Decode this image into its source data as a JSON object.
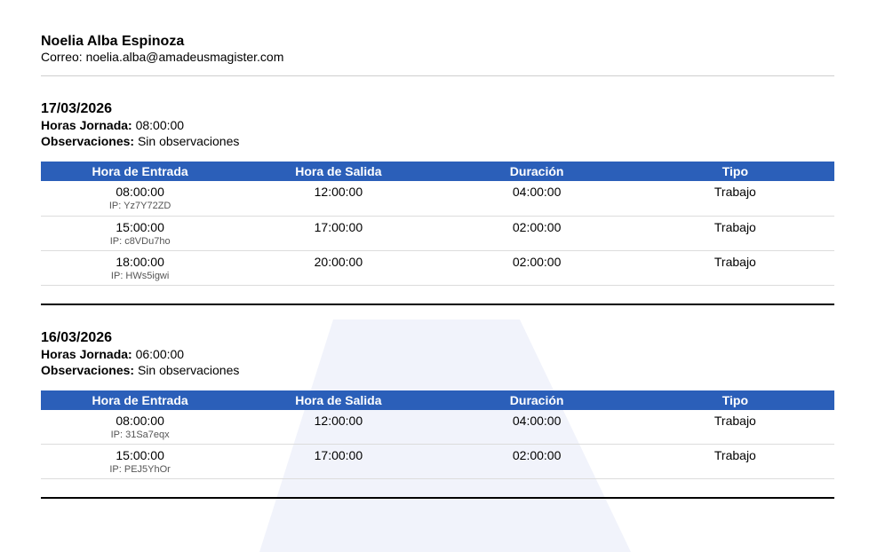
{
  "colors": {
    "accent": "#2b5fb9",
    "watermark": "#f1f3fb"
  },
  "person": {
    "name": "Noelia Alba Espinoza",
    "email_label": "Correo:",
    "email": "noelia.alba@amadeusmagister.com"
  },
  "labels": {
    "hours": "Horas Jornada:",
    "observations": "Observaciones:"
  },
  "columns": [
    "Hora de Entrada",
    "Hora de Salida",
    "Duración",
    "Tipo"
  ],
  "days": [
    {
      "date": "17/03/2026",
      "hours": "08:00:00",
      "observations": "Sin observaciones",
      "rows": [
        {
          "entry": "08:00:00",
          "ip": "IP: Yz7Y72ZD",
          "exit": "12:00:00",
          "duration": "04:00:00",
          "type": "Trabajo"
        },
        {
          "entry": "15:00:00",
          "ip": "IP: c8VDu7ho",
          "exit": "17:00:00",
          "duration": "02:00:00",
          "type": "Trabajo"
        },
        {
          "entry": "18:00:00",
          "ip": "IP: HWs5igwi",
          "exit": "20:00:00",
          "duration": "02:00:00",
          "type": "Trabajo"
        }
      ]
    },
    {
      "date": "16/03/2026",
      "hours": "06:00:00",
      "observations": "Sin observaciones",
      "rows": [
        {
          "entry": "08:00:00",
          "ip": "IP: 31Sa7eqx",
          "exit": "12:00:00",
          "duration": "04:00:00",
          "type": "Trabajo"
        },
        {
          "entry": "15:00:00",
          "ip": "IP: PEJ5YhOr",
          "exit": "17:00:00",
          "duration": "02:00:00",
          "type": "Trabajo"
        }
      ]
    }
  ]
}
